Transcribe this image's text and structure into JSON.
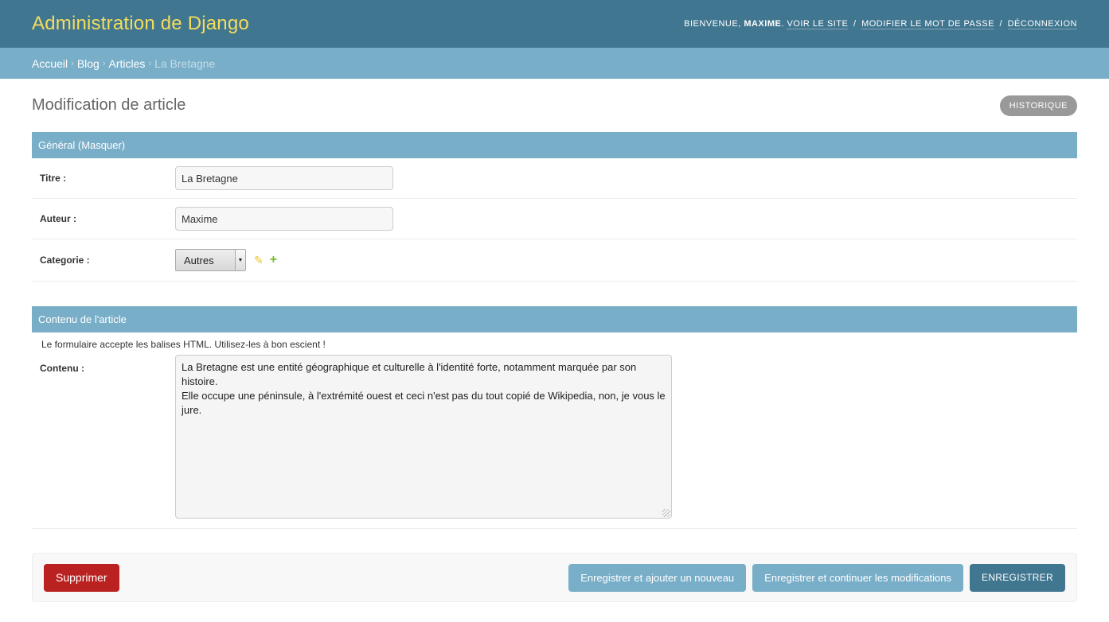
{
  "header": {
    "branding": "Administration de Django",
    "welcome": "Bienvenue,",
    "username": "Maxime",
    "view_site": "Voir le site",
    "change_password": "Modifier le mot de passe",
    "logout": "Déconnexion",
    "separator": "/"
  },
  "breadcrumbs": {
    "home": "Accueil",
    "app": "Blog",
    "model": "Articles",
    "current": "La Bretagne",
    "arrow": "›"
  },
  "page": {
    "title": "Modification de article",
    "history_label": "Historique"
  },
  "fieldset_general": {
    "heading": "Général (Masquer)",
    "titre_label": "Titre :",
    "titre_value": "La Bretagne",
    "auteur_label": "Auteur :",
    "auteur_value": "Maxime",
    "categorie_label": "Categorie :",
    "categorie_value": "Autres"
  },
  "fieldset_contenu": {
    "heading": "Contenu de l'article",
    "help_text": "Le formulaire accepte les balises HTML. Utilisez-les à bon escient !",
    "contenu_label": "Contenu :",
    "contenu_line1": "La Bretagne est une entité géographique et culturelle à l'identité forte, notamment marquée par son histoire.",
    "contenu_line2": "Elle occupe une péninsule, à l'extrémité ouest et ceci n'est pas du tout copié de Wikipedia, non, je vous le jure."
  },
  "submit_row": {
    "delete_label": "Supprimer",
    "save_add_label": "Enregistrer et ajouter un nouveau",
    "save_continue_label": "Enregistrer et continuer les modifications",
    "save_label": "Enregistrer"
  },
  "colors": {
    "header_bg": "#417690",
    "branding": "#f5dd5d",
    "breadcrumbs_bg": "#79aec8",
    "delete": "#ba2121",
    "primary": "#417690",
    "secondary": "#79aec8"
  }
}
